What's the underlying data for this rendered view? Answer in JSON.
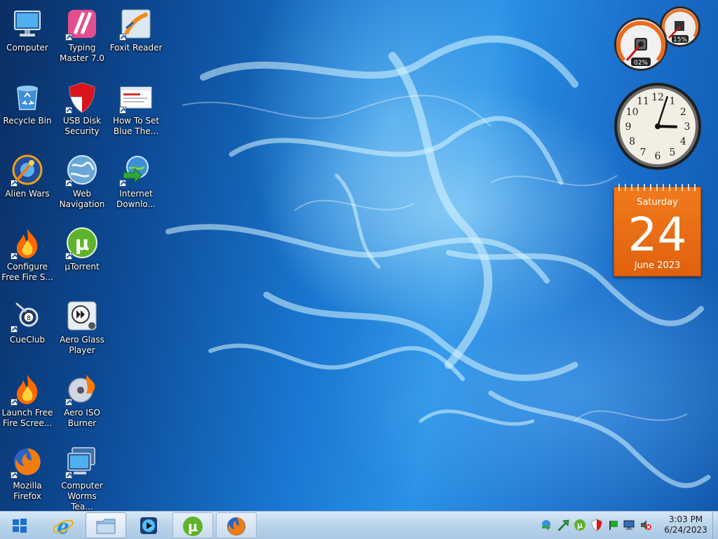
{
  "desktop_icons": [
    {
      "id": "computer",
      "label": "Computer",
      "icon": "monitor-icon"
    },
    {
      "id": "typing-master",
      "label": "Typing Master 7.0",
      "icon": "typing-master-icon"
    },
    {
      "id": "foxit",
      "label": "Foxit Reader",
      "icon": "foxit-icon"
    },
    {
      "id": "recycle-bin",
      "label": "Recycle Bin",
      "icon": "recycle-bin-icon"
    },
    {
      "id": "usb-security",
      "label": "USB Disk Security",
      "icon": "shield-icon"
    },
    {
      "id": "how-to",
      "label": "How To Set Blue The...",
      "icon": "webpage-icon"
    },
    {
      "id": "alien-wars",
      "label": "Alien Wars",
      "icon": "alien-wars-icon"
    },
    {
      "id": "web-navigation",
      "label": "Web Navigation",
      "icon": "globe-icon"
    },
    {
      "id": "internet-download",
      "label": "Internet Downlo...",
      "icon": "idm-icon"
    },
    {
      "id": "configure-fire",
      "label": "Configure Free Fire S...",
      "icon": "flame-icon"
    },
    {
      "id": "utorrent",
      "label": "µTorrent",
      "icon": "utorrent-icon"
    },
    {
      "id": "cueclub",
      "label": "CueClub",
      "icon": "cueclub-icon"
    },
    {
      "id": "aero-glass",
      "label": "Aero Glass Player",
      "icon": "media-player-icon"
    },
    {
      "id": "launch-fire",
      "label": "Launch Free Fire Scree...",
      "icon": "flame-icon"
    },
    {
      "id": "aero-iso",
      "label": "Aero ISO Burner",
      "icon": "disc-burner-icon"
    },
    {
      "id": "firefox",
      "label": "Mozilla Firefox",
      "icon": "firefox-icon"
    },
    {
      "id": "computer-worms",
      "label": "Computer Worms Tea...",
      "icon": "computer-worms-icon"
    }
  ],
  "gadgets": {
    "cpu_meter": {
      "cpu_label": "02%",
      "memory_label": "15%",
      "cpu_percent": 2,
      "memory_percent": 15
    },
    "clock": {
      "hour": 3,
      "minute": 3,
      "numbers": [
        "12",
        "1",
        "2",
        "3",
        "4",
        "5",
        "6",
        "7",
        "8",
        "9",
        "10",
        "11"
      ]
    },
    "calendar": {
      "weekday": "Saturday",
      "day": "24",
      "month_year": "June 2023"
    }
  },
  "taskbar": {
    "start_icon": "windows-logo-icon",
    "pinned": [
      {
        "id": "ie",
        "icon": "internet-explorer-icon"
      },
      {
        "id": "explorer",
        "icon": "folder-icon",
        "active": true
      },
      {
        "id": "media",
        "icon": "media-player-icon"
      },
      {
        "id": "utorrent",
        "icon": "utorrent-icon"
      },
      {
        "id": "firefox",
        "icon": "firefox-icon"
      }
    ],
    "tray_icons": [
      "idm-tray-icon",
      "green-arrow-icon",
      "utorrent-tray-icon",
      "shield-tray-icon",
      "flag-icon",
      "network-icon",
      "volume-muted-icon"
    ],
    "time": "3:03 PM",
    "date": "6/24/2023"
  },
  "colors": {
    "calendar_orange": "#e8690f",
    "taskbar_blue": "#bcd5ec",
    "desktop_blue": "#1976d0"
  }
}
